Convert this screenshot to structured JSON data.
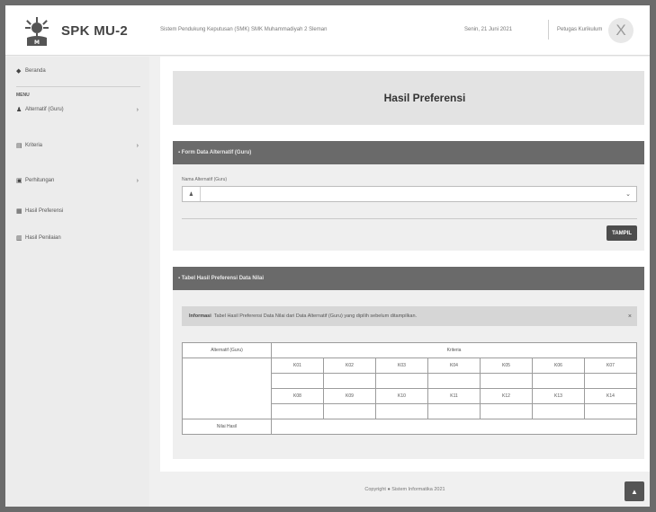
{
  "brand": {
    "name": "SPK MU-2"
  },
  "header": {
    "school": "Sistem Pendukung Keputusan (SMK) SMK Muhammadiyah 2 Sleman",
    "date": "Senin, 21 Juni 2021",
    "user": "Petugas Kurikulum",
    "avatar_glyph": "X"
  },
  "sidebar": {
    "dashboard": "Beranda",
    "section_header": "MENU",
    "items": [
      {
        "label": "Alternatif (Guru)",
        "icon": "user-icon",
        "has_caret": true
      },
      {
        "label": "Kriteria",
        "icon": "table-icon",
        "has_caret": true
      },
      {
        "label": "Perhitungan",
        "icon": "calculator-icon",
        "has_caret": true
      },
      {
        "label": "Hasil Preferensi",
        "icon": "chart-icon",
        "has_caret": false
      },
      {
        "label": "Hasil Penilaian",
        "icon": "clipboard-icon",
        "has_caret": false
      }
    ]
  },
  "main": {
    "page_title": "Hasil Preferensi",
    "form_panel": {
      "title": "Form Data Alternatif (Guru)",
      "field_label": "Nama Alternatif (Guru)",
      "select_value": "",
      "button_label": "TAMPIL"
    },
    "result_panel": {
      "title": "Tabel Hasil Preferensi Data Nilai",
      "note_label": "Informasi",
      "note_text": "Tabel Hasil Preferensi Data Nilai dari Data Alternatif (Guru) yang dipilih sebelum ditampilkan.",
      "table": {
        "col_header": "Alternatif (Guru)",
        "group_header": "Kriteria",
        "row1": [
          "K01",
          "K02",
          "K03",
          "K04",
          "K05",
          "K06",
          "K07"
        ],
        "row3": [
          "K08",
          "K09",
          "K10",
          "K11",
          "K12",
          "K13",
          "K14"
        ],
        "total_label": "Nilai Hasil"
      }
    }
  },
  "footer": {
    "text": "Copyright ● Sistem Informatika 2021"
  }
}
